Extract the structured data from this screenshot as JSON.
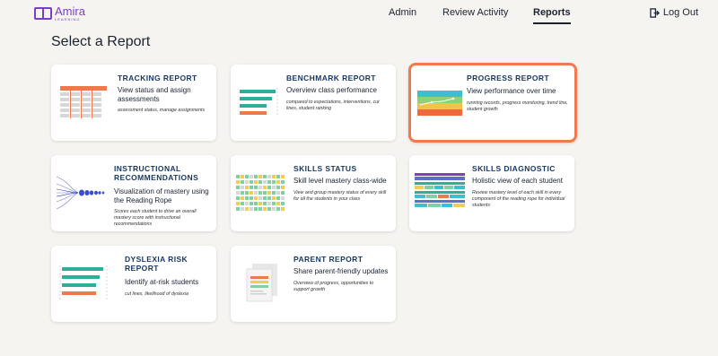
{
  "brand": {
    "name": "Amira",
    "sub": "LEARNING"
  },
  "nav": {
    "admin": "Admin",
    "review": "Review Activity",
    "reports": "Reports",
    "logout": "Log Out"
  },
  "page": {
    "title": "Select a Report"
  },
  "cards": [
    {
      "title": "TRACKING REPORT",
      "subtitle": "View status and assign assessments",
      "desc": "assessment status, manage assignments"
    },
    {
      "title": "BENCHMARK REPORT",
      "subtitle": "Overview class performance",
      "desc": "compared to expectations, interventions, cut lines, student ranking"
    },
    {
      "title": "PROGRESS REPORT",
      "subtitle": "View performance over time",
      "desc": "running records, progress monitoring, trend line, student growth"
    },
    {
      "title": "INSTRUCTIONAL RECOMMENDATIONS",
      "subtitle": "Visualization of mastery using the Reading Rope",
      "desc": "Scores each student to drive an overall mastery score with instructional recommendations"
    },
    {
      "title": "SKILLS STATUS",
      "subtitle": "Skill level mastery class-wide",
      "desc": "View and group mastery status of every skill for all the students in your class"
    },
    {
      "title": "SKILLS DIAGNOSTIC",
      "subtitle": "Holistic view of each student",
      "desc": "Review mastery level of each skill in every component of the reading rope for individual students"
    },
    {
      "title": "DYSLEXIA RISK REPORT",
      "subtitle": "Identify at-risk students",
      "desc": "cut lines, likelihood of dyslexia"
    },
    {
      "title": "PARENT REPORT",
      "subtitle": "Share parent-friendly updates",
      "desc": "Overview of progress, opportunities to support growth"
    }
  ],
  "colors": {
    "accent": "#ef7a4f",
    "brand": "#7a3fc2",
    "title": "#16365f",
    "teal": "#2fae9a",
    "orange": "#ee7a4c"
  }
}
